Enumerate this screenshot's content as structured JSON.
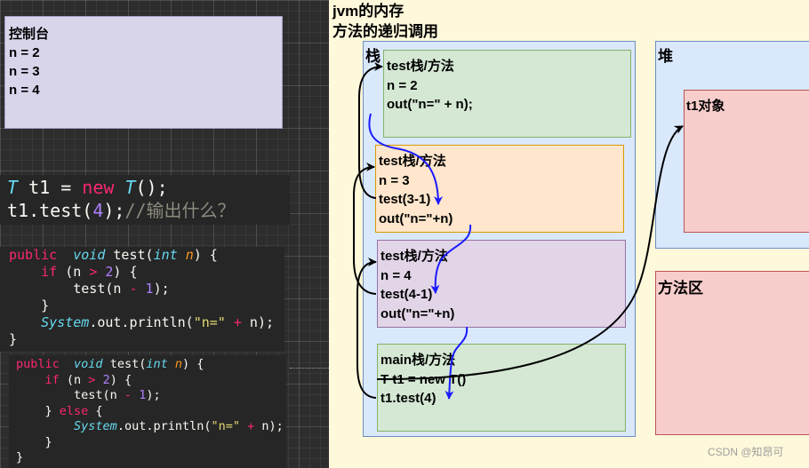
{
  "console": {
    "title": "控制台",
    "lines": [
      "n = 2",
      "n = 3",
      "n = 4"
    ]
  },
  "code_snippets": [
    {
      "lines": [
        [
          [
            "T",
            "#66d9ef",
            true
          ],
          [
            " t1 = ",
            "#f8f8f2"
          ],
          [
            "new",
            "#f92672"
          ],
          [
            " ",
            "#f8f8f2"
          ],
          [
            "T",
            "#66d9ef",
            true
          ],
          [
            "();",
            "#f8f8f2"
          ]
        ],
        [
          [
            "t1.test(",
            "#f8f8f2"
          ],
          [
            "4",
            "#ae81ff"
          ],
          [
            ");",
            "#f8f8f2"
          ],
          [
            "//输出什么？",
            "#8c8a7e"
          ]
        ]
      ]
    },
    {
      "lines": [
        [
          [
            "public",
            "#f92672"
          ],
          [
            "  ",
            "#f8f8f2"
          ],
          [
            "void",
            "#66d9ef",
            true
          ],
          [
            " test(",
            "#f8f8f2"
          ],
          [
            "int",
            "#66d9ef",
            true
          ],
          [
            " ",
            "#f8f8f2"
          ],
          [
            "n",
            "#fd971f",
            true
          ],
          [
            ") {",
            "#f8f8f2"
          ]
        ],
        [
          [
            "    ",
            "#f8f8f2"
          ],
          [
            "if",
            "#f92672"
          ],
          [
            " (n ",
            "#f8f8f2"
          ],
          [
            ">",
            "#f92672"
          ],
          [
            " ",
            "#f8f8f2"
          ],
          [
            "2",
            "#ae81ff"
          ],
          [
            ") {",
            "#f8f8f2"
          ]
        ],
        [
          [
            "        test(n ",
            "#f8f8f2"
          ],
          [
            "-",
            "#f92672"
          ],
          [
            " ",
            "#f8f8f2"
          ],
          [
            "1",
            "#ae81ff"
          ],
          [
            ");",
            "#f8f8f2"
          ]
        ],
        [
          [
            "    }",
            "#f8f8f2"
          ]
        ],
        [
          [
            "    ",
            "#f8f8f2"
          ],
          [
            "System",
            "#66d9ef",
            true
          ],
          [
            ".out.println(",
            "#f8f8f2"
          ],
          [
            "\"n=\"",
            "#e6db74"
          ],
          [
            " ",
            "#f8f8f2"
          ],
          [
            "+",
            "#f92672"
          ],
          [
            " n);",
            "#f8f8f2"
          ]
        ],
        [
          [
            "}",
            "#f8f8f2"
          ]
        ]
      ]
    },
    {
      "lines": [
        [
          [
            "public",
            "#f92672"
          ],
          [
            "  ",
            "#f8f8f2"
          ],
          [
            "void",
            "#66d9ef",
            true
          ],
          [
            " test(",
            "#f8f8f2"
          ],
          [
            "int",
            "#66d9ef",
            true
          ],
          [
            " ",
            "#f8f8f2"
          ],
          [
            "n",
            "#fd971f",
            true
          ],
          [
            ") {",
            "#f8f8f2"
          ]
        ],
        [
          [
            "    ",
            "#f8f8f2"
          ],
          [
            "if",
            "#f92672"
          ],
          [
            " (n ",
            "#f8f8f2"
          ],
          [
            ">",
            "#f92672"
          ],
          [
            " ",
            "#f8f8f2"
          ],
          [
            "2",
            "#ae81ff"
          ],
          [
            ") {",
            "#f8f8f2"
          ]
        ],
        [
          [
            "        test(n ",
            "#f8f8f2"
          ],
          [
            "-",
            "#f92672"
          ],
          [
            " ",
            "#f8f8f2"
          ],
          [
            "1",
            "#ae81ff"
          ],
          [
            ");",
            "#f8f8f2"
          ]
        ],
        [
          [
            "    } ",
            "#f8f8f2"
          ],
          [
            "else",
            "#f92672"
          ],
          [
            " {",
            "#f8f8f2"
          ]
        ],
        [
          [
            "        ",
            "#f8f8f2"
          ],
          [
            "System",
            "#66d9ef",
            true
          ],
          [
            ".out.println(",
            "#f8f8f2"
          ],
          [
            "\"n=\"",
            "#e6db74"
          ],
          [
            " ",
            "#f8f8f2"
          ],
          [
            "+",
            "#f92672"
          ],
          [
            " n);",
            "#f8f8f2"
          ]
        ],
        [
          [
            "    }",
            "#f8f8f2"
          ]
        ],
        [
          [
            "}",
            "#f8f8f2"
          ]
        ]
      ]
    }
  ],
  "diagram": {
    "title": "jvm的内存",
    "subtitle": "方法的递归调用",
    "stack": {
      "label": "栈",
      "frames": [
        {
          "lines": [
            "test栈/方法",
            "n = 2",
            "out(\"n=\" + n);"
          ]
        },
        {
          "lines": [
            "test栈/方法",
            "n = 3",
            "test(3-1)",
            "out(\"n=\"+n)"
          ]
        },
        {
          "lines": [
            "test栈/方法",
            "n = 4",
            "test(4-1)",
            "out(\"n=\"+n)"
          ]
        },
        {
          "lines": [
            "main栈/方法",
            "T t1 = new T()",
            "t1.test(4)"
          ]
        }
      ]
    },
    "heap": {
      "label": "堆",
      "objects": [
        "t1对象"
      ]
    },
    "method_area": {
      "label": "方法区"
    }
  },
  "watermark": "CSDN @知昂可",
  "colors": {
    "canvas_background": "#2d2d2d",
    "code_background": "#262626",
    "console_fill": "#d8d5eb",
    "console_stroke": "#a29dc6",
    "panel_fill": "#fff9db",
    "stack_fill": "#dae8fc",
    "stack_stroke": "#6c8ebf",
    "frame_green_fill": "#d5e8d4",
    "frame_green_stroke": "#82b366",
    "frame_orange_fill": "#ffe6cc",
    "frame_orange_stroke": "#d79b00",
    "frame_purple_fill": "#e1d5e7",
    "frame_purple_stroke": "#9673a6",
    "object_fill": "#f8cecc",
    "object_stroke": "#b85450",
    "call_arrow": "#000000",
    "return_arrow": "#1a1aff",
    "watermark_text": "#9e9e9e"
  }
}
